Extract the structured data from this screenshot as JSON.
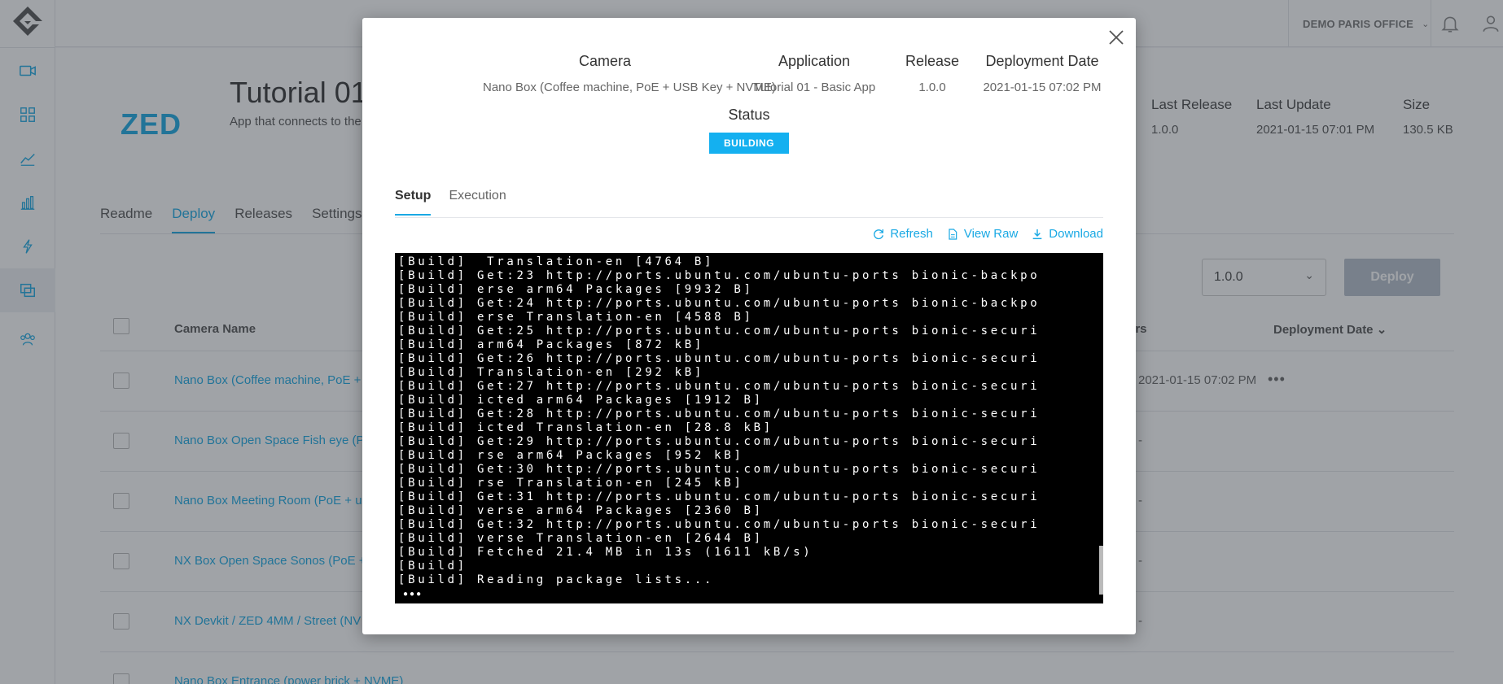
{
  "header": {
    "office": "DEMO PARIS OFFICE"
  },
  "sidebar": {
    "items": [
      {
        "icon": "camera-icon"
      },
      {
        "icon": "dashboard-icon"
      },
      {
        "icon": "trend-icon"
      },
      {
        "icon": "bar-chart-icon"
      },
      {
        "icon": "flash-icon"
      },
      {
        "icon": "apps-icon",
        "active": true
      },
      {
        "icon": "users-icon"
      }
    ]
  },
  "app": {
    "logo_text": "ZED",
    "title": "Tutorial 01",
    "description": "App that connects to the",
    "meta": {
      "last_release_label": "Last Release",
      "last_release_value": "1.0.0",
      "last_update_label": "Last Update",
      "last_update_value": "2021-01-15 07:01 PM",
      "size_label": "Size",
      "size_value": "130.5 KB"
    },
    "tabs": [
      "Readme",
      "Deploy",
      "Releases",
      "Settings"
    ],
    "active_tab": "Deploy",
    "version_select": "1.0.0",
    "deploy_button": "Deploy",
    "table": {
      "col_camera": "Camera Name",
      "col_partial": "ters",
      "col_deploy_date": "Deployment Date",
      "rows": [
        {
          "name": "Nano Box (Coffee machine, PoE +",
          "date": "2021-01-15 07:02 PM",
          "more": "•••"
        },
        {
          "name": "Nano Box Open Space Fish eye (P",
          "date": "-"
        },
        {
          "name": "Nano Box Meeting Room (PoE + u",
          "date": "-"
        },
        {
          "name": "NX Box Open Space Sonos (PoE +",
          "date": "-"
        },
        {
          "name": "NX Devkit / ZED 4MM / Street (NV",
          "date": "-"
        },
        {
          "name": "Nano Box Entrance (power brick + NVME)",
          "date": ""
        }
      ]
    }
  },
  "modal": {
    "camera_label": "Camera",
    "camera_value": "Nano Box (Coffee machine, PoE + USB Key + NVME)",
    "application_label": "Application",
    "application_value": "Tutorial 01 - Basic App",
    "release_label": "Release",
    "release_value": "1.0.0",
    "date_label": "Deployment Date",
    "date_value": "2021-01-15 07:02 PM",
    "status_label": "Status",
    "status_value": "BUILDING",
    "tabs": [
      "Setup",
      "Execution"
    ],
    "active_tab": "Setup",
    "actions": {
      "refresh": "Refresh",
      "view_raw": "View Raw",
      "download": "Download"
    },
    "console_lines": [
      "[Build]  Translation-en [4764 B]",
      "[Build] Get:23 http://ports.ubuntu.com/ubuntu-ports bionic-backpo",
      "[Build] erse arm64 Packages [9932 B]",
      "[Build] Get:24 http://ports.ubuntu.com/ubuntu-ports bionic-backpo",
      "[Build] erse Translation-en [4588 B]",
      "[Build] Get:25 http://ports.ubuntu.com/ubuntu-ports bionic-securi",
      "[Build] arm64 Packages [872 kB]",
      "[Build] Get:26 http://ports.ubuntu.com/ubuntu-ports bionic-securi",
      "[Build] Translation-en [292 kB]",
      "[Build] Get:27 http://ports.ubuntu.com/ubuntu-ports bionic-securi",
      "[Build] icted arm64 Packages [1912 B]",
      "[Build] Get:28 http://ports.ubuntu.com/ubuntu-ports bionic-securi",
      "[Build] icted Translation-en [28.8 kB]",
      "[Build] Get:29 http://ports.ubuntu.com/ubuntu-ports bionic-securi",
      "[Build] rse arm64 Packages [952 kB]",
      "[Build] Get:30 http://ports.ubuntu.com/ubuntu-ports bionic-securi",
      "[Build] rse Translation-en [245 kB]",
      "[Build] Get:31 http://ports.ubuntu.com/ubuntu-ports bionic-securi",
      "[Build] verse arm64 Packages [2360 B]",
      "[Build] Get:32 http://ports.ubuntu.com/ubuntu-ports bionic-securi",
      "[Build] verse Translation-en [2644 B]",
      "[Build] Fetched 21.4 MB in 13s (1611 kB/s)",
      "[Build]",
      "[Build] Reading package lists..."
    ],
    "loading_dots": "●●●"
  }
}
